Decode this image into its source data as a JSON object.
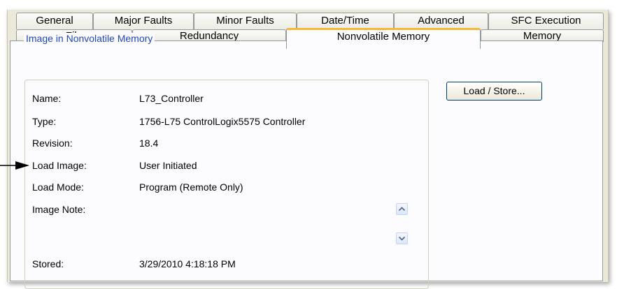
{
  "tabs_row1": [
    "General",
    "Major Faults",
    "Minor Faults",
    "Date/Time",
    "Advanced",
    "SFC Execution"
  ],
  "tabs_row2": [
    "File",
    "Redundancy",
    "Nonvolatile Memory",
    "Memory"
  ],
  "active_tab": "Nonvolatile Memory",
  "group": {
    "title": "Image in Nonvolatile Memory",
    "fields": [
      {
        "label": "Name:",
        "value": "L73_Controller"
      },
      {
        "label": "Type:",
        "value": "1756-L75 ControlLogix5575 Controller"
      },
      {
        "label": "Revision:",
        "value": "18.4"
      },
      {
        "label": "Load Image:",
        "value": "User Initiated"
      },
      {
        "label": "Load Mode:",
        "value": "Program (Remote Only)"
      },
      {
        "label": "Image Note:",
        "value": ""
      },
      {
        "label": "Stored:",
        "value": "3/29/2010  4:18:18 PM"
      }
    ]
  },
  "load_store_button": "Load / Store...",
  "icons": {
    "pointer": "arrow-right-icon",
    "scroll_up": "scroll-up-arrow-icon",
    "scroll_down": "scroll-down-arrow-icon"
  },
  "colors": {
    "active_tab_accent": "#f5b836",
    "group_title": "#1f44b8",
    "tab_border": "#919b9c"
  }
}
